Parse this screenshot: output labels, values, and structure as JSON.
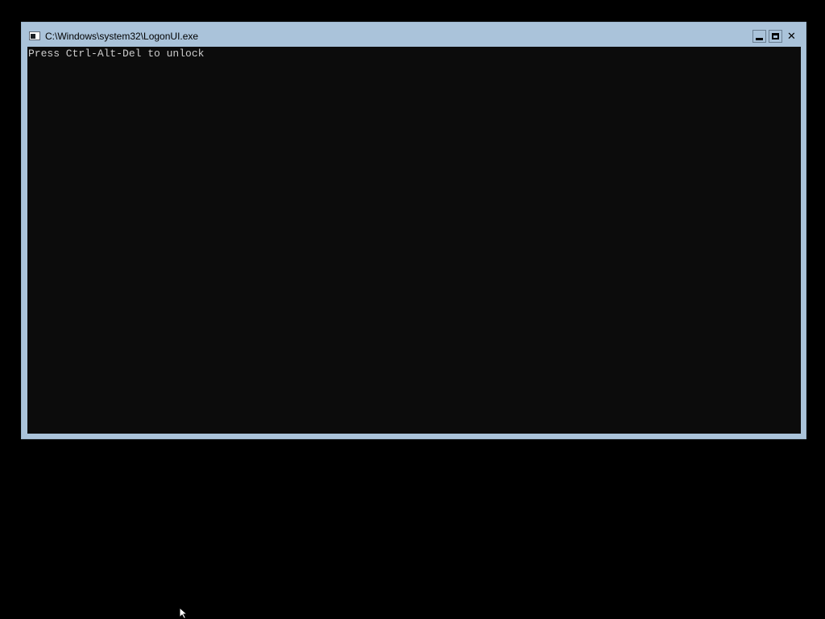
{
  "window": {
    "title": "C:\\Windows\\system32\\LogonUI.exe",
    "icon": "console-app-icon",
    "controls": {
      "minimize": "minimize-icon",
      "maximize": "maximize-icon",
      "close": "close-icon",
      "close_glyph": "✕"
    }
  },
  "console": {
    "lines": [
      "Press Ctrl-Alt-Del to unlock"
    ],
    "background": "#0c0c0c",
    "foreground": "#cccccc"
  },
  "colors": {
    "desktop": "#000000",
    "window_frame": "#aac3da"
  },
  "pointer": "mouse-cursor-icon"
}
